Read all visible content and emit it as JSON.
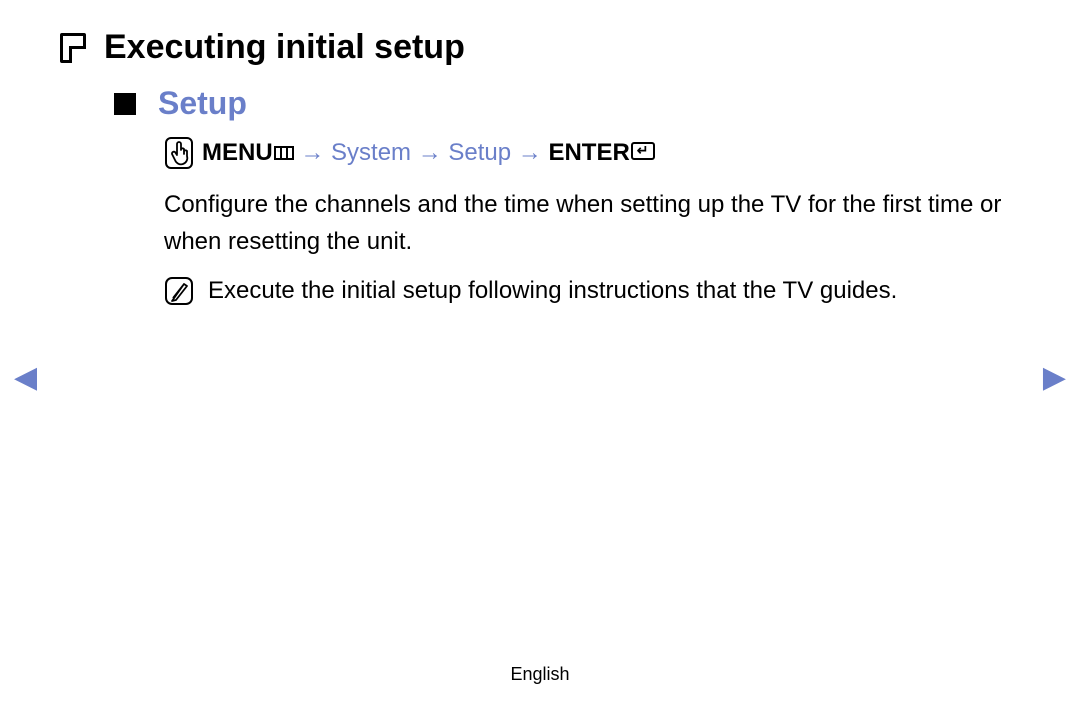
{
  "page": {
    "title": "Executing initial setup",
    "section_title": "Setup",
    "nav_path": {
      "menu_label": "MENU",
      "arrow": "→",
      "step1": "System",
      "step2": "Setup",
      "enter_label": "ENTER"
    },
    "body": "Configure the channels and the time when setting up the TV for the first time or when resetting the unit.",
    "note": "Execute the initial setup following instructions that the TV guides."
  },
  "nav": {
    "prev": "◀",
    "next": "▶"
  },
  "footer": {
    "language": "English"
  }
}
